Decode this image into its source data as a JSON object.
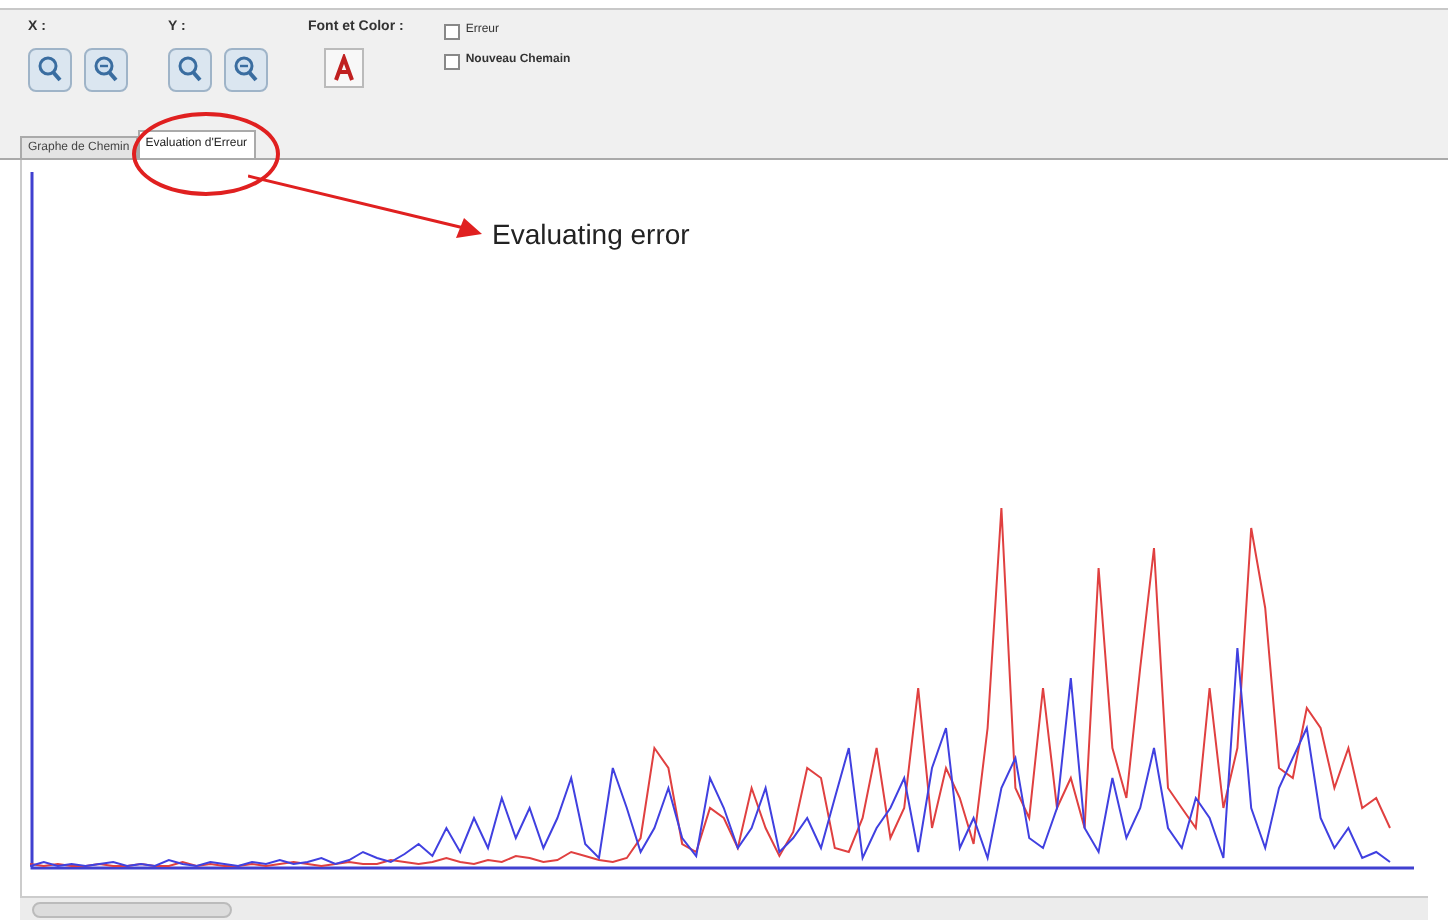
{
  "toolbar": {
    "groups": [
      {
        "label": "X :",
        "kind": "zoom"
      },
      {
        "label": "Y :",
        "kind": "zoom"
      },
      {
        "label": "Font et Color :",
        "kind": "font"
      }
    ],
    "checkboxes": [
      {
        "label": "Erreur",
        "checked": false,
        "bold": false
      },
      {
        "label": "Nouveau Chemain",
        "checked": false,
        "bold": true
      }
    ]
  },
  "tabs": [
    {
      "label": "Graphe de Chemin",
      "selected": false
    },
    {
      "label": "Evaluation d'Erreur",
      "selected": true
    }
  ],
  "annotation": {
    "text": "Evaluating error"
  }
}
